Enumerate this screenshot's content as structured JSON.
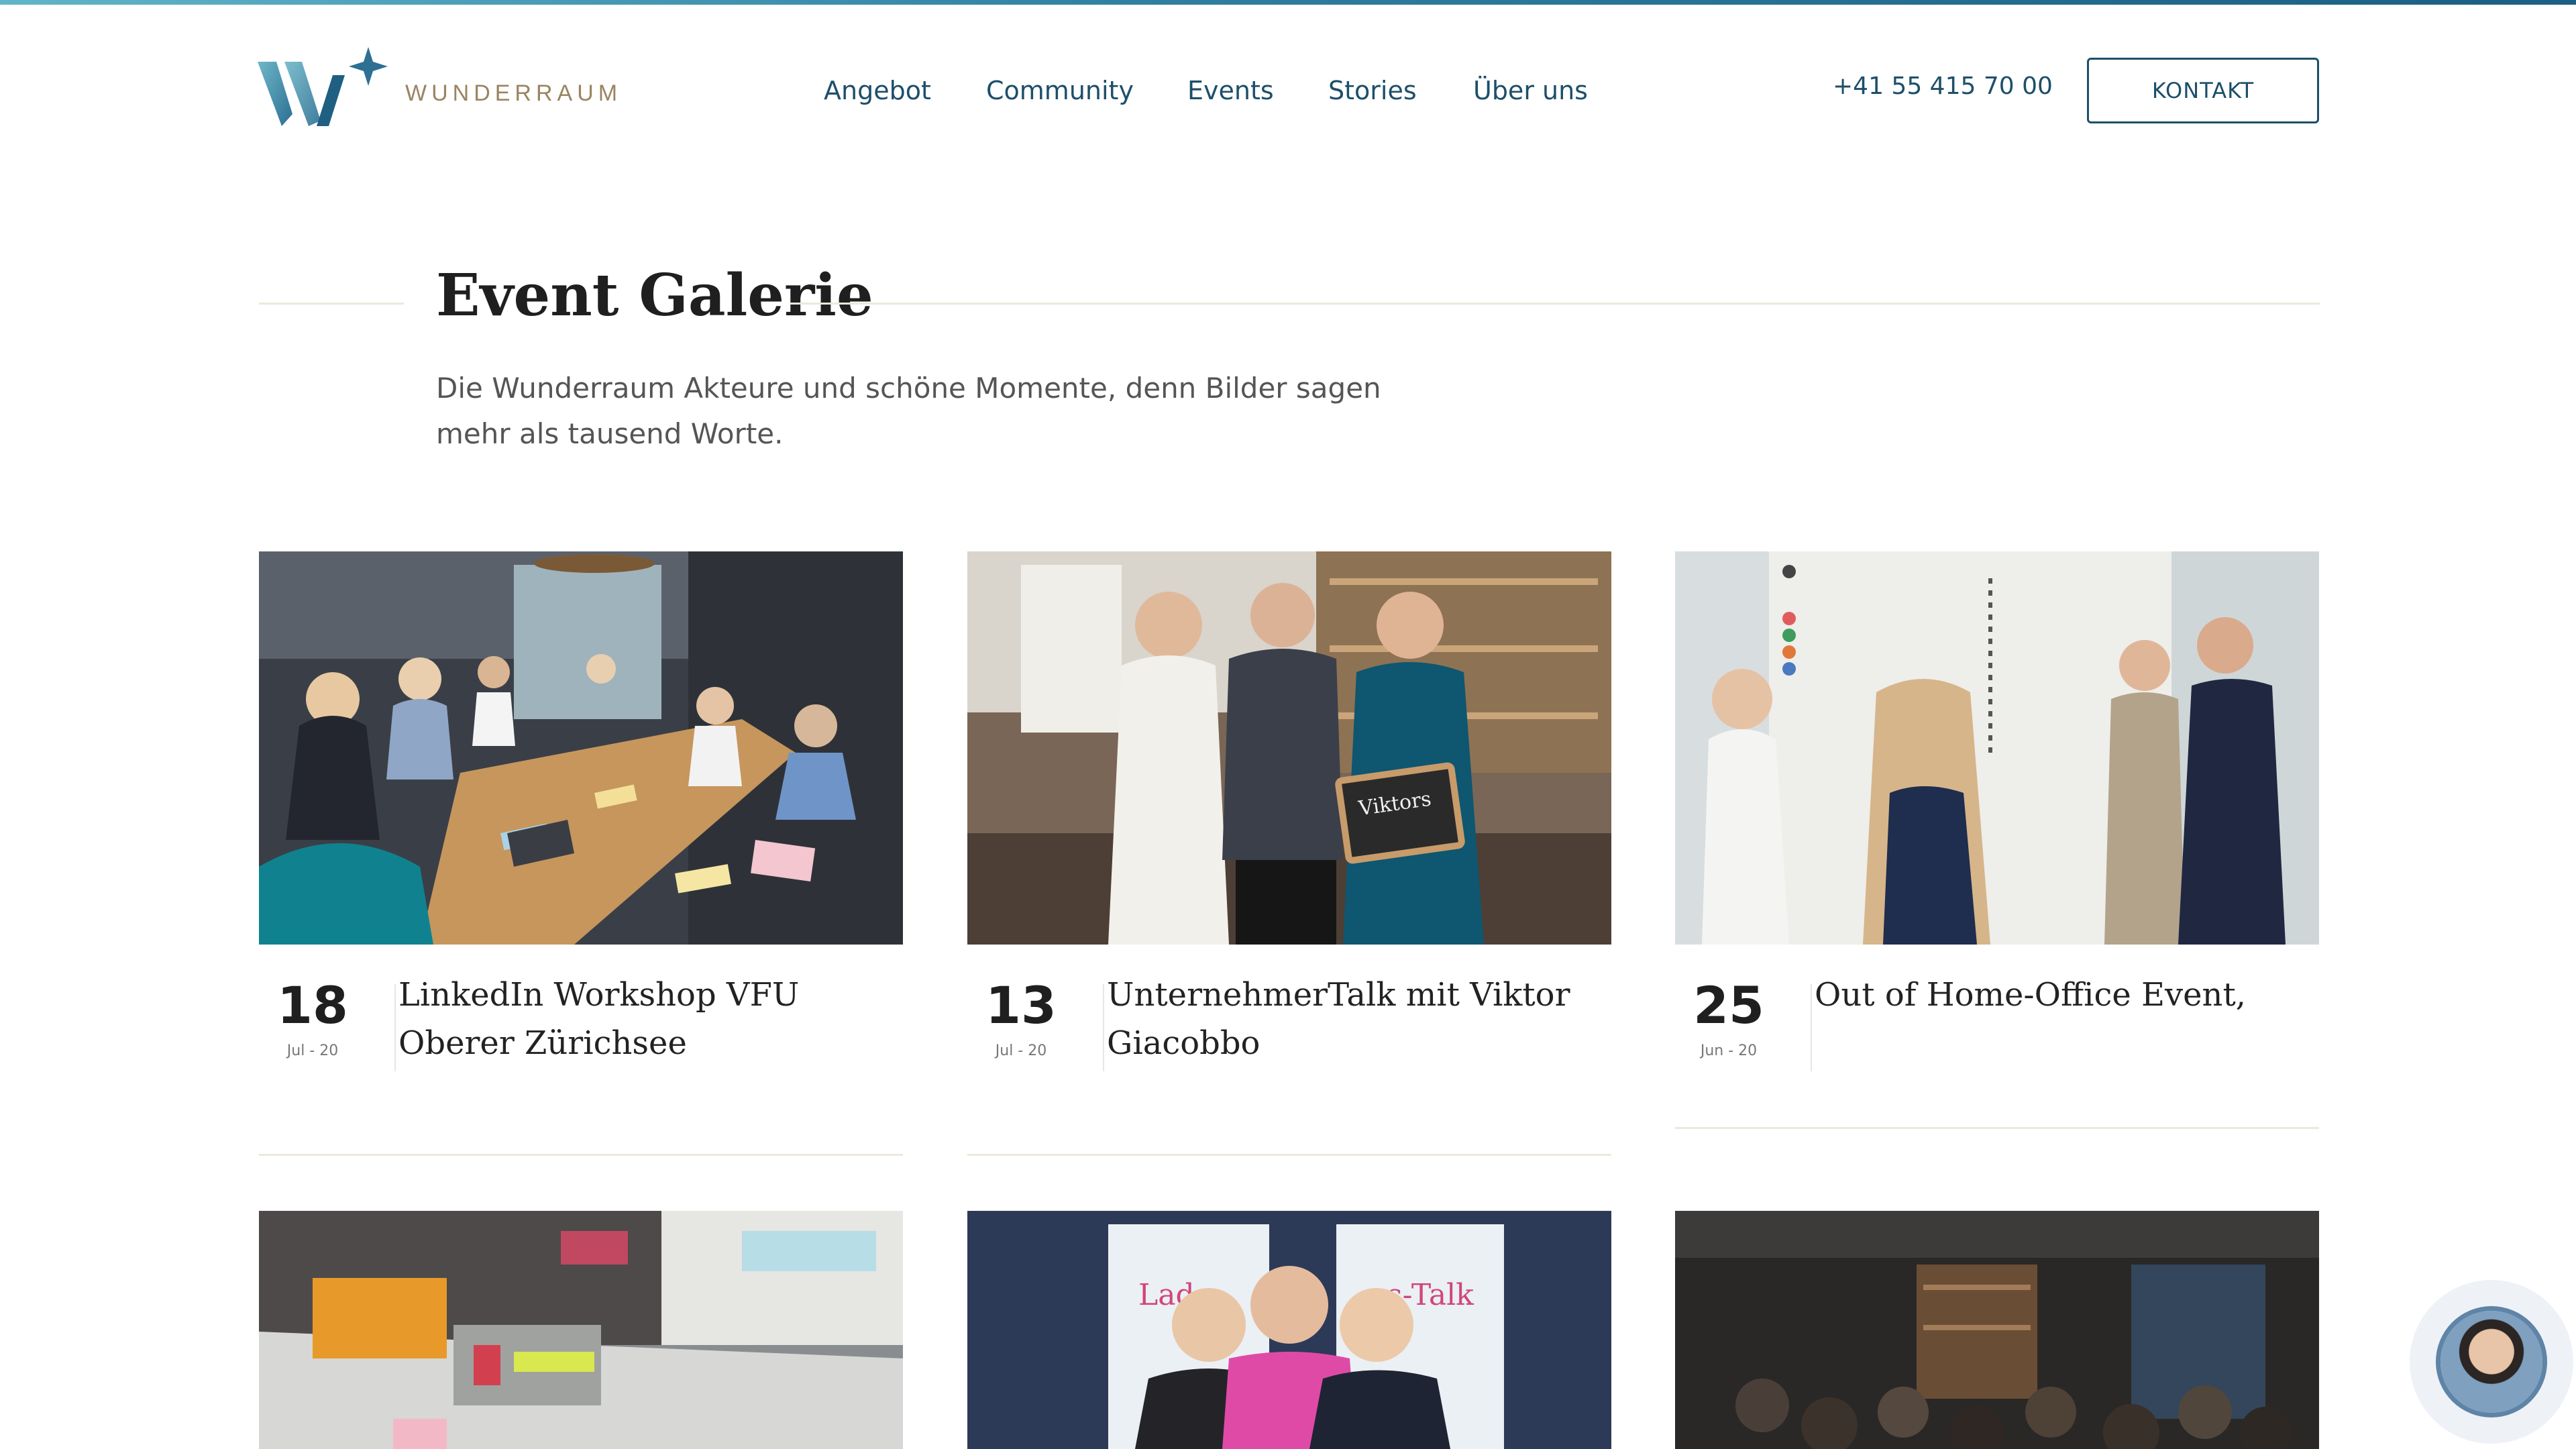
{
  "brand": {
    "name": "WUNDERRAUM",
    "colors": {
      "primary": "#1d4f6a",
      "gold": "#9a8460",
      "accent": "#2f7fa0"
    }
  },
  "nav": {
    "items": [
      "Angebot",
      "Community",
      "Events",
      "Stories",
      "Über uns"
    ]
  },
  "header": {
    "phone": "+41 55 415 70 00",
    "contact_label": "KONTAKT"
  },
  "section": {
    "title": "Event Galerie",
    "intro": "Die Wunderraum Akteure und schöne Momente, denn Bilder sagen mehr als tausend Worte."
  },
  "events": [
    {
      "day": "18",
      "month": "Jul - 20",
      "title": "LinkedIn Workshop VFU Oberer Zürichsee"
    },
    {
      "day": "13",
      "month": "Jul - 20",
      "title": "UnternehmerTalk mit Viktor Giacobbo"
    },
    {
      "day": "25",
      "month": "Jun - 20",
      "title": "Out of Home-Office Event,"
    }
  ],
  "chat": {
    "icon": "chat-avatar-icon"
  }
}
